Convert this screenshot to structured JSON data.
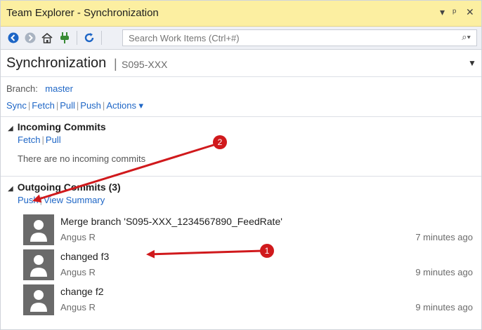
{
  "window": {
    "title": "Team Explorer - Synchronization",
    "pin_icon": "pin-icon",
    "close_icon": "close-icon"
  },
  "toolbar": {
    "icons": [
      "back-icon",
      "forward-icon",
      "home-icon",
      "connect-icon",
      "refresh-icon"
    ],
    "search_placeholder": "Search Work Items (Ctrl+#)"
  },
  "header": {
    "title": "Synchronization",
    "separator": "|",
    "repo": "S095-XXX"
  },
  "branch": {
    "label": "Branch:",
    "value": "master"
  },
  "actions": {
    "sync": "Sync",
    "fetch": "Fetch",
    "pull": "Pull",
    "push": "Push",
    "actions": "Actions ▾"
  },
  "incoming": {
    "title": "Incoming Commits",
    "fetch": "Fetch",
    "pull": "Pull",
    "empty": "There are no incoming commits"
  },
  "outgoing": {
    "title": "Outgoing Commits (3)",
    "push": "Push",
    "view_summary": "View Summary",
    "commits": [
      {
        "message": "Merge branch 'S095-XXX_1234567890_FeedRate'",
        "author": "Angus R",
        "time": "7 minutes ago"
      },
      {
        "message": "changed f3",
        "author": "Angus R",
        "time": "9 minutes ago"
      },
      {
        "message": "change f2",
        "author": "Angus R",
        "time": "9 minutes ago"
      }
    ]
  },
  "annotations": {
    "badge1": "1",
    "badge2": "2",
    "color": "#d0191c"
  },
  "colors": {
    "titlebar": "#fcefa1",
    "link": "#1e66c6"
  }
}
